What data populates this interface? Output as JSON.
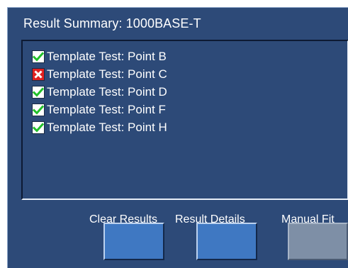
{
  "panel": {
    "title": "Result Summary: 1000BASE-T"
  },
  "results": [
    {
      "label": "Template Test: Point B",
      "status": "pass",
      "icon": "check-icon"
    },
    {
      "label": "Template Test: Point C",
      "status": "fail",
      "icon": "x-icon"
    },
    {
      "label": "Template Test: Point D",
      "status": "pass",
      "icon": "check-icon"
    },
    {
      "label": "Template Test: Point F",
      "status": "pass",
      "icon": "check-icon"
    },
    {
      "label": "Template Test: Point H",
      "status": "pass",
      "icon": "check-icon"
    }
  ],
  "buttons": {
    "clear_results": "Clear Results",
    "result_details": "Result Details",
    "manual_fit": "Manual Fit"
  },
  "colors": {
    "panel_bg": "#2d4a78",
    "button_bg": "#3f78c2",
    "pass_check": "#22c02a",
    "fail_bg": "#e02020"
  }
}
